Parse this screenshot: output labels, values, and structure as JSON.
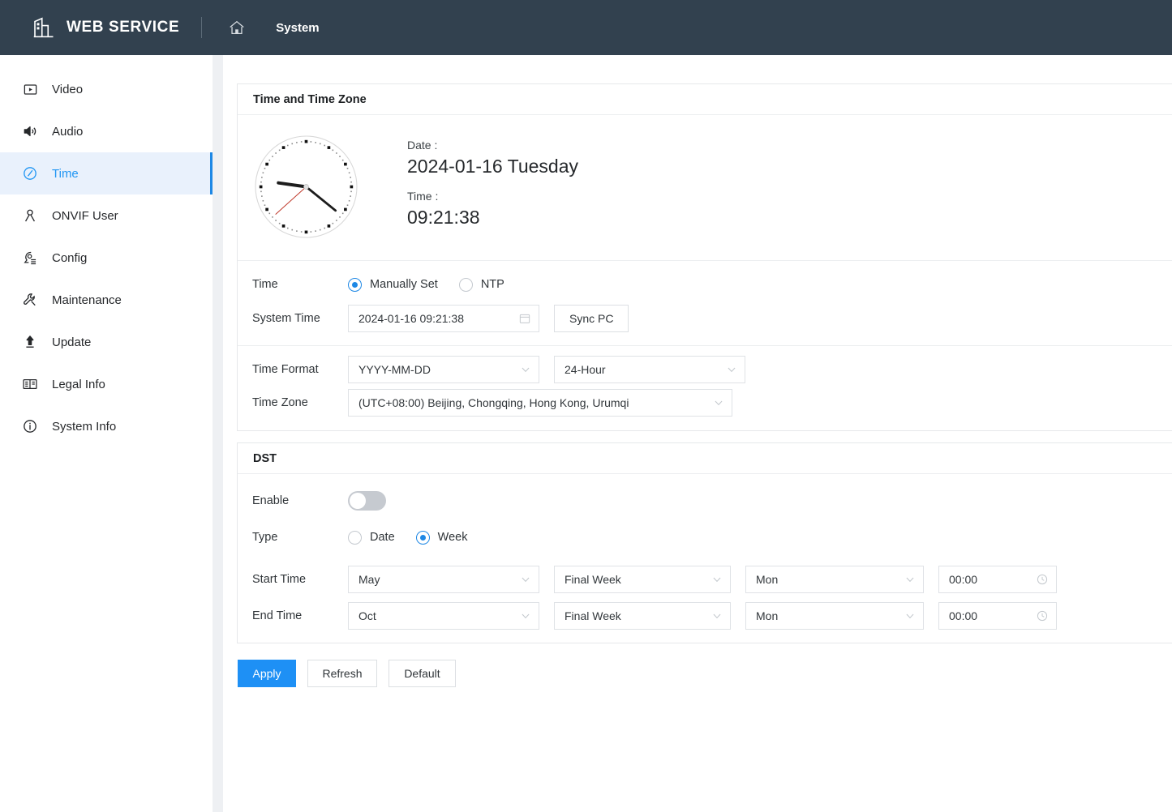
{
  "header": {
    "logo_icon": "building-icon",
    "brand": "WEB SERVICE",
    "home_icon": "home-icon",
    "nav": "System"
  },
  "sidebar": {
    "items": [
      {
        "label": "Video",
        "icon": "video-icon",
        "active": false
      },
      {
        "label": "Audio",
        "icon": "audio-icon",
        "active": false
      },
      {
        "label": "Time",
        "icon": "clock-icon",
        "active": true
      },
      {
        "label": "ONVIF User",
        "icon": "user-icon",
        "active": false
      },
      {
        "label": "Config",
        "icon": "config-gear-icon",
        "active": false
      },
      {
        "label": "Maintenance",
        "icon": "wrench-icon",
        "active": false
      },
      {
        "label": "Update",
        "icon": "upload-arrow-icon",
        "active": false
      },
      {
        "label": "Legal Info",
        "icon": "book-icon",
        "active": false
      },
      {
        "label": "System Info",
        "icon": "info-icon",
        "active": false
      }
    ]
  },
  "time_card": {
    "title": "Time and Time Zone",
    "clock": {
      "icon": "analog-clock",
      "hour_deg": 278,
      "minute_deg": 129,
      "second_deg": 228,
      "second_hand_color": "#c0392b",
      "hand_color": "#1c1c1c"
    },
    "date_label": "Date :",
    "date_value": "2024-01-16 Tuesday",
    "time_label": "Time :",
    "time_value": "09:21:38",
    "time_mode": {
      "label": "Time",
      "options": [
        {
          "label": "Manually Set",
          "selected": true
        },
        {
          "label": "NTP",
          "selected": false
        }
      ]
    },
    "system_time": {
      "label": "System Time",
      "value": "2024-01-16 09:21:38",
      "icon": "calendar-icon",
      "sync_button": "Sync PC"
    },
    "time_format": {
      "label": "Time Format",
      "date_value": "YYYY-MM-DD",
      "hour_value": "24-Hour"
    },
    "time_zone": {
      "label": "Time Zone",
      "value": "(UTC+08:00) Beijing, Chongqing, Hong Kong, Urumqi"
    }
  },
  "dst_card": {
    "title": "DST",
    "enable_label": "Enable",
    "enable_on": false,
    "type_label": "Type",
    "type_options": [
      {
        "label": "Date",
        "selected": false
      },
      {
        "label": "Week",
        "selected": true
      }
    ],
    "start": {
      "label": "Start Time",
      "month": "May",
      "week": "Final Week",
      "day": "Mon",
      "time": "00:00",
      "time_icon": "clock-icon"
    },
    "end": {
      "label": "End Time",
      "month": "Oct",
      "week": "Final Week",
      "day": "Mon",
      "time": "00:00",
      "time_icon": "clock-icon"
    }
  },
  "actions": {
    "apply": "Apply",
    "refresh": "Refresh",
    "default": "Default"
  },
  "colors": {
    "topbar": "#32414f",
    "accent": "#1e88e5",
    "primary_button": "#1e90f5",
    "active_row": "#e9f1fc"
  }
}
